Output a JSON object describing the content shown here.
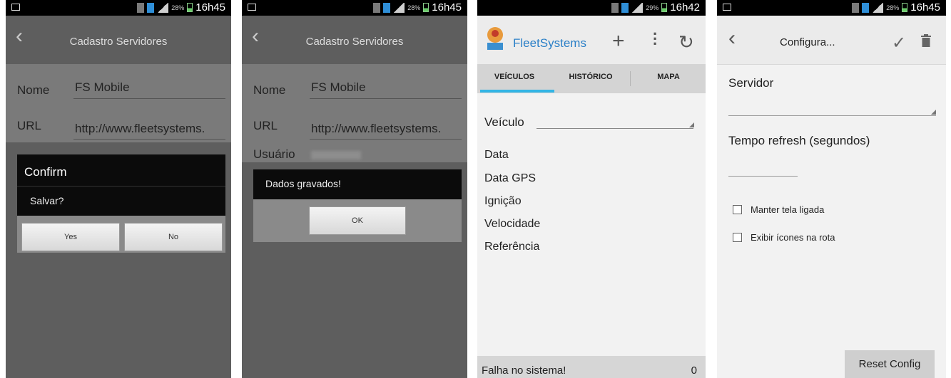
{
  "status": {
    "battery_a": "28%",
    "time_a": "16h45",
    "battery_c": "29%",
    "time_c": "16h42"
  },
  "screen1": {
    "title": "Cadastro Servidores",
    "nome_label": "Nome",
    "nome_value": "FS Mobile",
    "url_label": "URL",
    "url_value": "http://www.fleetsystems.",
    "dialog_title": "Confirm",
    "dialog_message": "Salvar?",
    "yes": "Yes",
    "no": "No"
  },
  "screen2": {
    "title": "Cadastro Servidores",
    "nome_label": "Nome",
    "nome_value": "FS Mobile",
    "url_label": "URL",
    "url_value": "http://www.fleetsystems.",
    "usuario_label": "Usuário",
    "dialog_message": "Dados gravados!",
    "ok": "OK"
  },
  "screen3": {
    "app_name": "FleetSystems",
    "tabs": [
      "VEÍCULOS",
      "HISTÓRICO",
      "MAPA"
    ],
    "veiculo_label": "Veículo",
    "info": [
      "Data",
      "Data GPS",
      "Ignição",
      "Velocidade",
      "Referência"
    ],
    "footer_text": "Falha no sistema!",
    "footer_count": "0"
  },
  "screen4": {
    "title": "Configura...",
    "servidor_label": "Servidor",
    "refresh_label": "Tempo refresh (segundos)",
    "check1": "Manter tela ligada",
    "check2": "Exibir ícones na rota",
    "reset": "Reset Config"
  },
  "colors": {
    "dark_bg": "#6b6b6b",
    "dialog": "#0b0b0b",
    "tab_accent": "#33b5e5",
    "light_bg": "#f2f2f2"
  },
  "icons": [
    "back-icon",
    "add-icon",
    "overflow-menu-icon",
    "refresh-icon",
    "check-icon",
    "trash-icon",
    "gallery-icon",
    "app-logo-icon"
  ]
}
